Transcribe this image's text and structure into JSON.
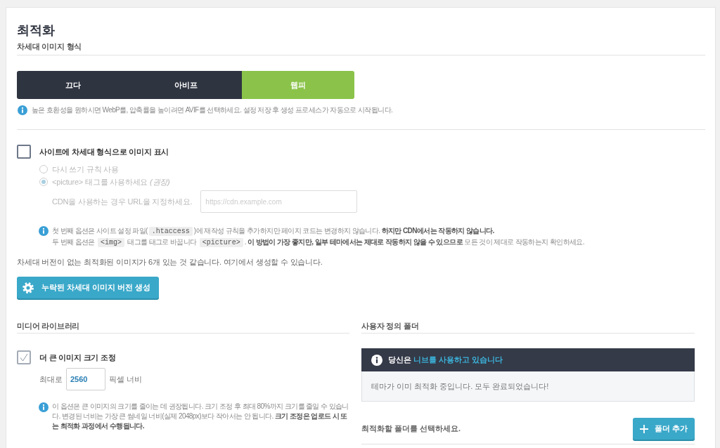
{
  "page": {
    "title": "최적화",
    "subtitle": "차세대 이미지 형식"
  },
  "format_tabs": [
    {
      "label": "끄다",
      "selected": false
    },
    {
      "label": "아비프",
      "selected": false
    },
    {
      "label": "웹피",
      "selected": true
    }
  ],
  "format_hint": "높은 호환성을 원하시면 WebP를, 압축률을 높이려면 AVIF를 선택하세요. 설정 저장 후 생성 프로세스가 자동으로 시작됩니다.",
  "display_option": {
    "label": "사이트에 차세대 형식으로 이미지 표시",
    "checked": false,
    "methods": [
      {
        "label": "다시 쓰기 규칙 사용",
        "selected": false,
        "disabled": true
      },
      {
        "label": "<picture> 태그를 사용하세요 *(권장)*",
        "selected": true,
        "disabled": true
      }
    ],
    "cdn": {
      "label": "CDN을 사용하는 경우 URL을 지정하세요.",
      "placeholder": "https://cdn.example.com",
      "disabled": true
    },
    "note_lines": [
      [
        {
          "kind": "text",
          "text": "첫 번째 옵션은 사이트 설정 파일("
        },
        {
          "kind": "code",
          "text": ".htaccess"
        },
        {
          "kind": "text",
          "text": ")에 재작성 규칙을 추가하지만 페이지 코드는 변경하지 않습니다. **하지만 CDN에서는 작동하지 않습니다.**"
        }
      ],
      [
        {
          "kind": "text",
          "text": "두 번째 옵션은 "
        },
        {
          "kind": "code",
          "text": "<img>"
        },
        {
          "kind": "text",
          "text": " 태그를 태그로 바꿉니다 "
        },
        {
          "kind": "code",
          "text": "<picture>"
        },
        {
          "kind": "text",
          "text": ". **이 방법이 가장 좋지만, 일부 테마에서는 제대로 작동하지 않을 수 있으므로** 모든 것이 제대로 작동하는지 확인하세요."
        }
      ]
    ]
  },
  "generate": {
    "message": "차세대 버전이 없는 최적화된 이미지가 6개 있는 것 같습니다. 여기에서 생성할 수 있습니다.",
    "button": "누락된 차세대 이미지 버전 생성"
  },
  "media_library": {
    "heading": "미디어 라이브러리",
    "resize": {
      "label": "더 큰 이미지 크기 조정",
      "checked": true
    },
    "max_width": {
      "prefix": "최대로",
      "value": "2560",
      "suffix": "픽셀 너비"
    },
    "note": "이 옵션은 큰 이미지의 크기를 줄이는 데 권장됩니다. 크기 조정 후 최대 80%까지 크기를 줄일 수 있습니다. 변경된 너비는 가장 큰 썸네일 너비(실제 2048px)보다 작아서는 안 됩니다. **크기 조정은 업로드 시 또는 최적화 과정에서 수행됩니다.**"
  },
  "custom_folders": {
    "heading": "사용자 정의 폴더",
    "notice": {
      "title": "당신은",
      "link": "니브를 사용하고 있습니다",
      "body": "테마가 이미 최적화 중입니다. 모두 완료되었습니다!"
    },
    "prompt": "최적화할 폴더를 선택하세요.",
    "button": "폴더 추가"
  }
}
